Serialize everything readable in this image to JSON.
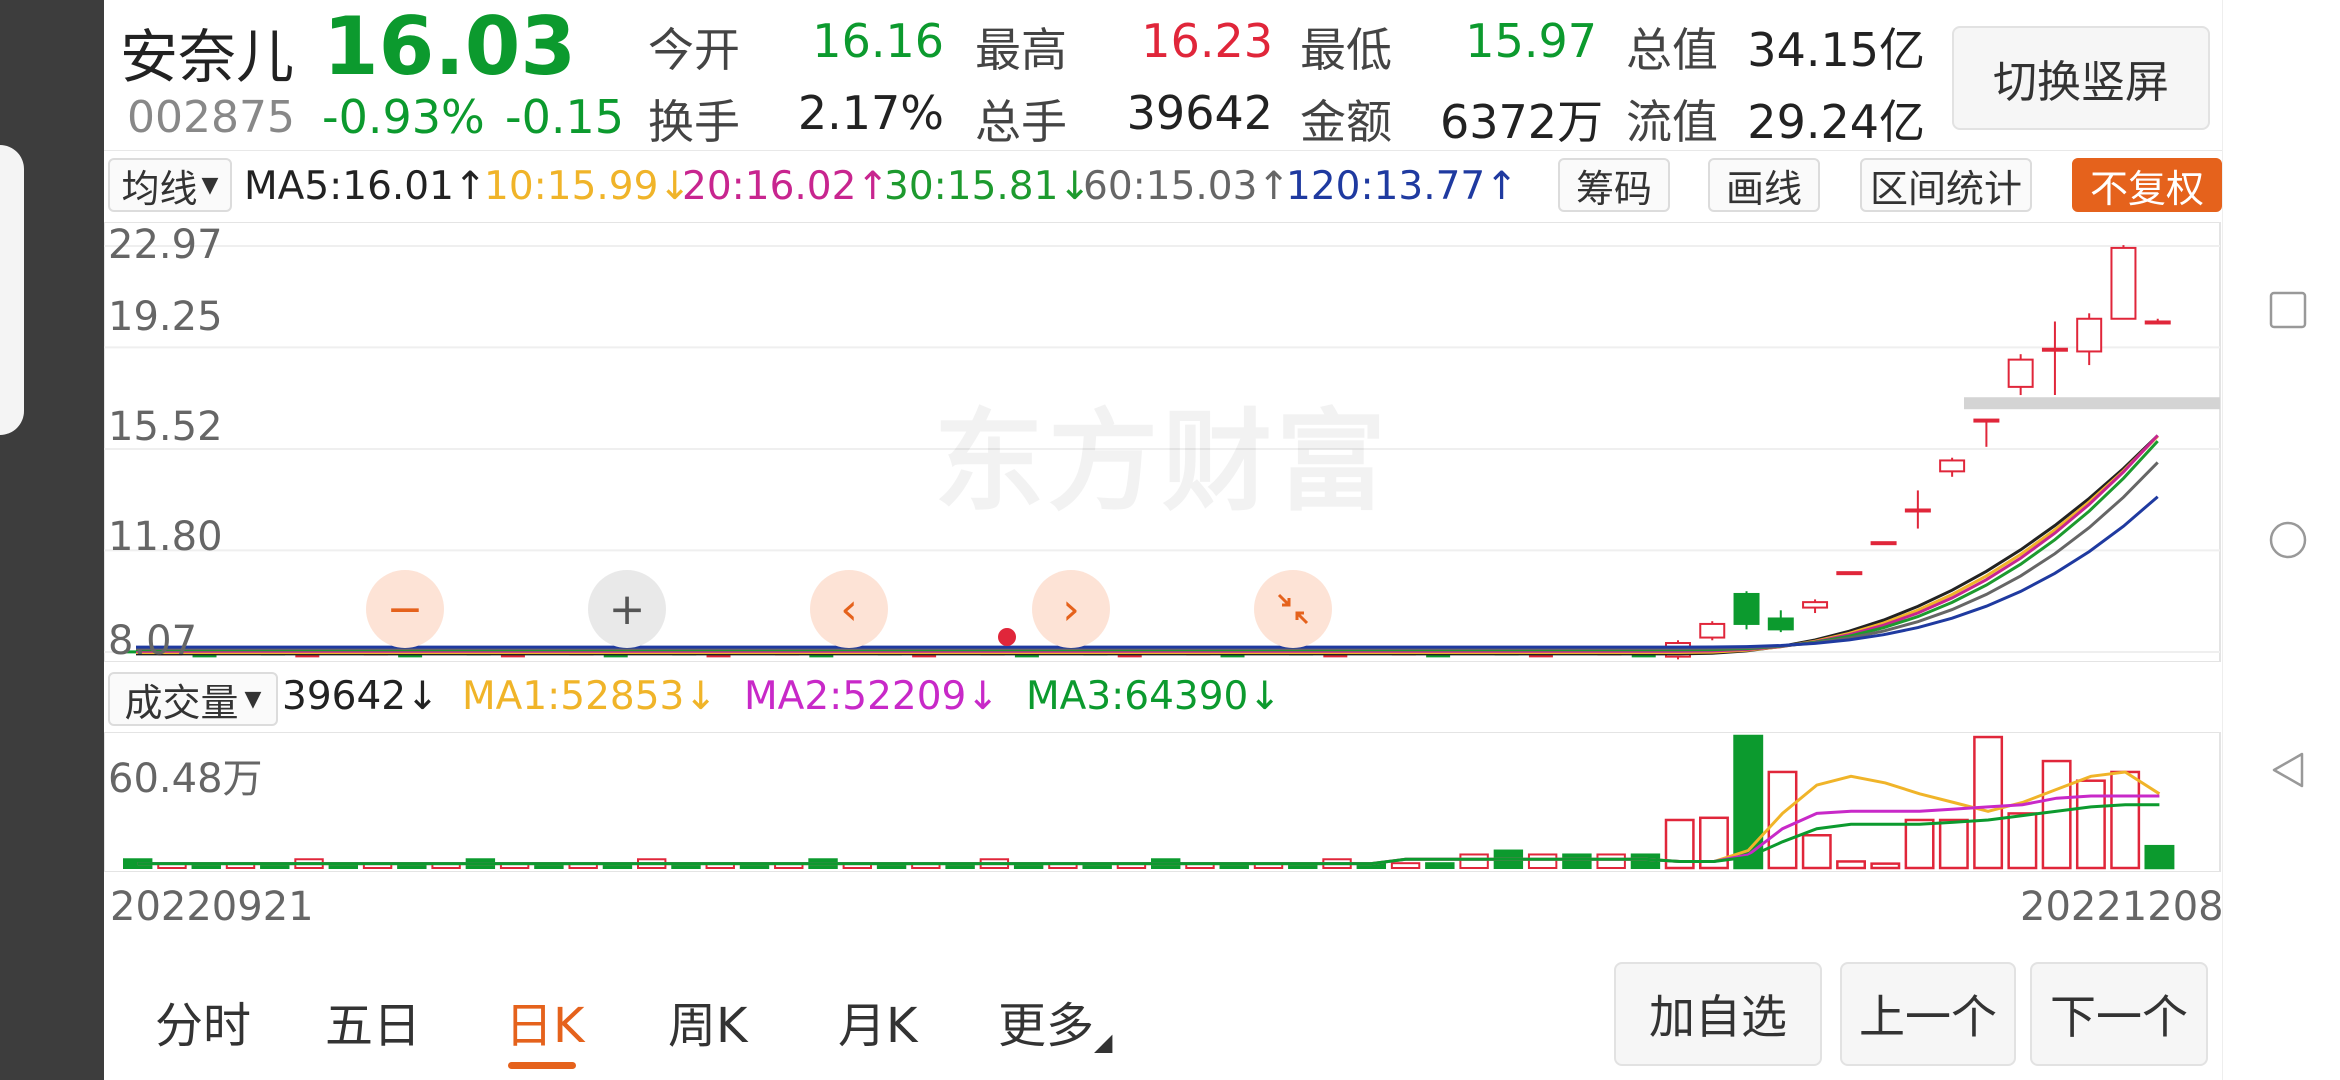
{
  "stock": {
    "name": "安奈儿",
    "price": "16.03",
    "code": "002875",
    "change_pct": "-0.93%",
    "change": "-0.15",
    "switch_label": "切换竖屏"
  },
  "quote": {
    "open_label": "今开",
    "open": "16.16",
    "high_label": "最高",
    "high": "16.23",
    "low_label": "最低",
    "low": "15.97",
    "mktcap_label": "总值",
    "mktcap": "34.15亿",
    "turnover_label": "换手",
    "turnover": "2.17%",
    "volume_label": "总手",
    "volume": "39642",
    "amount_label": "金额",
    "amount": "6372万",
    "float_label": "流值",
    "float": "29.24亿"
  },
  "ma_bar": {
    "selector": "均线",
    "ma5": "MA5:16.01↑",
    "ma10": "10:15.99↓",
    "ma20": "20:16.02↑",
    "ma30": "30:15.81↓",
    "ma60": "60:15.03↑",
    "ma120": "120:13.77↑",
    "chip_btn": "筹码",
    "draw_btn": "画线",
    "range_btn": "区间统计",
    "adjust_btn": "不复权"
  },
  "colors": {
    "up": "#e0263a",
    "down": "#0c9a2e",
    "ma5": "#222222",
    "ma10": "#f0b429",
    "ma20": "#c8258f",
    "ma30": "#1d9a2e",
    "ma60": "#666666",
    "ma120": "#1f3aa0",
    "accent": "#e5621c"
  },
  "watermark": "东方财富",
  "zoom_controls": [
    "minus-icon",
    "plus-icon",
    "chevron-left-icon",
    "chevron-right-icon",
    "shrink-icon"
  ],
  "vol_bar": {
    "selector": "成交量",
    "value": "39642↓",
    "ma1": "MA1:52853↓",
    "ma2": "MA2:52209↓",
    "ma3": "MA3:64390↓"
  },
  "dates": {
    "start": "20220921",
    "end": "20221208"
  },
  "tabs": [
    "分时",
    "五日",
    "日K",
    "周K",
    "月K",
    "更多"
  ],
  "active_tab": "日K",
  "buttons": {
    "add_watch": "加自选",
    "prev": "上一个",
    "next": "下一个"
  },
  "chart_data": [
    {
      "type": "candlestick",
      "title": "",
      "y_ticks": [
        "22.97",
        "19.25",
        "15.52",
        "11.80",
        "8.07"
      ],
      "ylim": [
        8.07,
        22.97
      ],
      "candles_recent": [
        {
          "o": 7.9,
          "c": 8.4,
          "h": 8.5,
          "l": 7.8
        },
        {
          "o": 8.6,
          "c": 9.1,
          "h": 9.2,
          "l": 8.5
        },
        {
          "o": 10.2,
          "c": 9.1,
          "h": 10.3,
          "l": 8.9
        },
        {
          "o": 9.3,
          "c": 8.9,
          "h": 9.6,
          "l": 8.8
        },
        {
          "o": 9.7,
          "c": 9.9,
          "h": 10.0,
          "l": 9.5
        },
        {
          "o": 11.0,
          "c": 11.0,
          "h": 11.0,
          "l": 11.0
        },
        {
          "o": 12.1,
          "c": 12.1,
          "h": 12.1,
          "l": 12.1
        },
        {
          "o": 13.3,
          "c": 13.3,
          "h": 14.0,
          "l": 12.6
        },
        {
          "o": 14.7,
          "c": 15.1,
          "h": 15.2,
          "l": 14.5
        },
        {
          "o": 16.6,
          "c": 16.6,
          "h": 16.6,
          "l": 15.6
        },
        {
          "o": 17.8,
          "c": 18.8,
          "h": 19.0,
          "l": 17.5
        },
        {
          "o": 19.2,
          "c": 19.2,
          "h": 20.2,
          "l": 17.5
        },
        {
          "o": 19.1,
          "c": 20.3,
          "h": 20.5,
          "l": 18.6
        },
        {
          "o": 20.3,
          "c": 22.9,
          "h": 23.0,
          "l": 20.3
        },
        {
          "o": 20.2,
          "c": 20.2,
          "h": 20.3,
          "l": 20.1
        }
      ],
      "flat_level": 8.0,
      "ma_end": {
        "MA5": 16.01,
        "MA10": 15.99,
        "MA20": 16.02,
        "MA30": 15.81,
        "MA60": 15.03,
        "MA120": 13.77
      }
    },
    {
      "type": "bar",
      "title": "",
      "y_ticks": [
        "60.48万"
      ],
      "ylim": [
        0,
        60.48
      ],
      "volumes_recent": [
        {
          "v": 22,
          "up": true
        },
        {
          "v": 23,
          "up": true
        },
        {
          "v": 60.48,
          "up": false
        },
        {
          "v": 44,
          "up": true
        },
        {
          "v": 15,
          "up": true
        },
        {
          "v": 3,
          "up": true
        },
        {
          "v": 2,
          "up": true
        },
        {
          "v": 22,
          "up": true
        },
        {
          "v": 22,
          "up": true
        },
        {
          "v": 60,
          "up": true
        },
        {
          "v": 25,
          "up": true
        },
        {
          "v": 49,
          "up": true
        },
        {
          "v": 40,
          "up": true
        },
        {
          "v": 44,
          "up": true
        },
        {
          "v": 10,
          "up": false
        }
      ]
    }
  ]
}
